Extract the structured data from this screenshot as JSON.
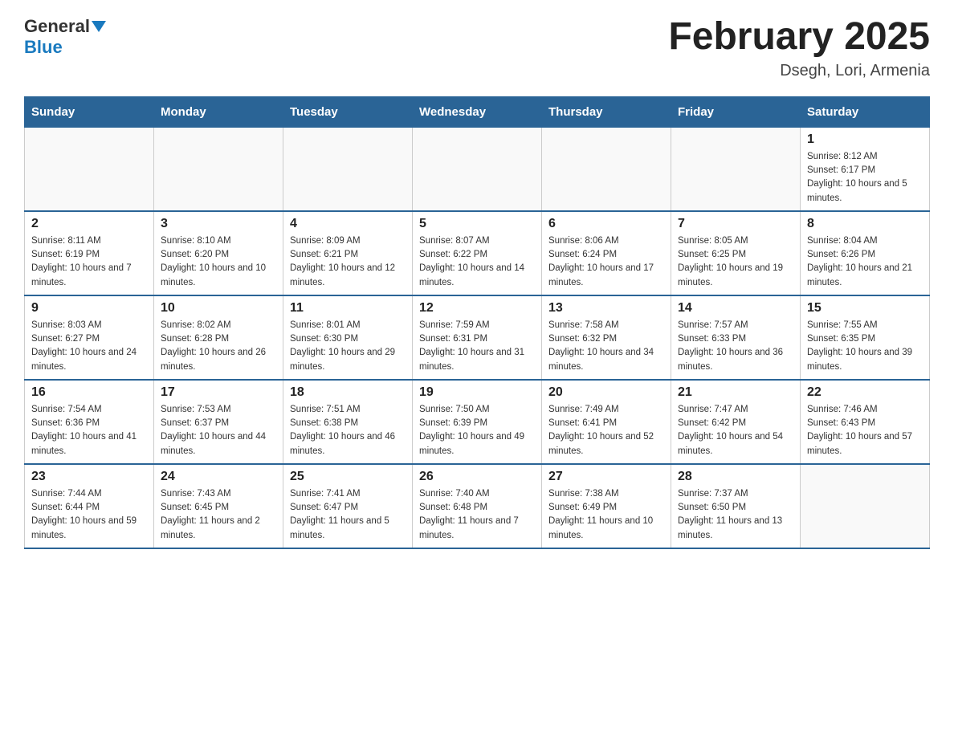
{
  "header": {
    "logo_general": "General",
    "logo_blue": "Blue",
    "month_title": "February 2025",
    "location": "Dsegh, Lori, Armenia"
  },
  "weekdays": [
    "Sunday",
    "Monday",
    "Tuesday",
    "Wednesday",
    "Thursday",
    "Friday",
    "Saturday"
  ],
  "weeks": [
    [
      {
        "day": "",
        "info": ""
      },
      {
        "day": "",
        "info": ""
      },
      {
        "day": "",
        "info": ""
      },
      {
        "day": "",
        "info": ""
      },
      {
        "day": "",
        "info": ""
      },
      {
        "day": "",
        "info": ""
      },
      {
        "day": "1",
        "info": "Sunrise: 8:12 AM\nSunset: 6:17 PM\nDaylight: 10 hours and 5 minutes."
      }
    ],
    [
      {
        "day": "2",
        "info": "Sunrise: 8:11 AM\nSunset: 6:19 PM\nDaylight: 10 hours and 7 minutes."
      },
      {
        "day": "3",
        "info": "Sunrise: 8:10 AM\nSunset: 6:20 PM\nDaylight: 10 hours and 10 minutes."
      },
      {
        "day": "4",
        "info": "Sunrise: 8:09 AM\nSunset: 6:21 PM\nDaylight: 10 hours and 12 minutes."
      },
      {
        "day": "5",
        "info": "Sunrise: 8:07 AM\nSunset: 6:22 PM\nDaylight: 10 hours and 14 minutes."
      },
      {
        "day": "6",
        "info": "Sunrise: 8:06 AM\nSunset: 6:24 PM\nDaylight: 10 hours and 17 minutes."
      },
      {
        "day": "7",
        "info": "Sunrise: 8:05 AM\nSunset: 6:25 PM\nDaylight: 10 hours and 19 minutes."
      },
      {
        "day": "8",
        "info": "Sunrise: 8:04 AM\nSunset: 6:26 PM\nDaylight: 10 hours and 21 minutes."
      }
    ],
    [
      {
        "day": "9",
        "info": "Sunrise: 8:03 AM\nSunset: 6:27 PM\nDaylight: 10 hours and 24 minutes."
      },
      {
        "day": "10",
        "info": "Sunrise: 8:02 AM\nSunset: 6:28 PM\nDaylight: 10 hours and 26 minutes."
      },
      {
        "day": "11",
        "info": "Sunrise: 8:01 AM\nSunset: 6:30 PM\nDaylight: 10 hours and 29 minutes."
      },
      {
        "day": "12",
        "info": "Sunrise: 7:59 AM\nSunset: 6:31 PM\nDaylight: 10 hours and 31 minutes."
      },
      {
        "day": "13",
        "info": "Sunrise: 7:58 AM\nSunset: 6:32 PM\nDaylight: 10 hours and 34 minutes."
      },
      {
        "day": "14",
        "info": "Sunrise: 7:57 AM\nSunset: 6:33 PM\nDaylight: 10 hours and 36 minutes."
      },
      {
        "day": "15",
        "info": "Sunrise: 7:55 AM\nSunset: 6:35 PM\nDaylight: 10 hours and 39 minutes."
      }
    ],
    [
      {
        "day": "16",
        "info": "Sunrise: 7:54 AM\nSunset: 6:36 PM\nDaylight: 10 hours and 41 minutes."
      },
      {
        "day": "17",
        "info": "Sunrise: 7:53 AM\nSunset: 6:37 PM\nDaylight: 10 hours and 44 minutes."
      },
      {
        "day": "18",
        "info": "Sunrise: 7:51 AM\nSunset: 6:38 PM\nDaylight: 10 hours and 46 minutes."
      },
      {
        "day": "19",
        "info": "Sunrise: 7:50 AM\nSunset: 6:39 PM\nDaylight: 10 hours and 49 minutes."
      },
      {
        "day": "20",
        "info": "Sunrise: 7:49 AM\nSunset: 6:41 PM\nDaylight: 10 hours and 52 minutes."
      },
      {
        "day": "21",
        "info": "Sunrise: 7:47 AM\nSunset: 6:42 PM\nDaylight: 10 hours and 54 minutes."
      },
      {
        "day": "22",
        "info": "Sunrise: 7:46 AM\nSunset: 6:43 PM\nDaylight: 10 hours and 57 minutes."
      }
    ],
    [
      {
        "day": "23",
        "info": "Sunrise: 7:44 AM\nSunset: 6:44 PM\nDaylight: 10 hours and 59 minutes."
      },
      {
        "day": "24",
        "info": "Sunrise: 7:43 AM\nSunset: 6:45 PM\nDaylight: 11 hours and 2 minutes."
      },
      {
        "day": "25",
        "info": "Sunrise: 7:41 AM\nSunset: 6:47 PM\nDaylight: 11 hours and 5 minutes."
      },
      {
        "day": "26",
        "info": "Sunrise: 7:40 AM\nSunset: 6:48 PM\nDaylight: 11 hours and 7 minutes."
      },
      {
        "day": "27",
        "info": "Sunrise: 7:38 AM\nSunset: 6:49 PM\nDaylight: 11 hours and 10 minutes."
      },
      {
        "day": "28",
        "info": "Sunrise: 7:37 AM\nSunset: 6:50 PM\nDaylight: 11 hours and 13 minutes."
      },
      {
        "day": "",
        "info": ""
      }
    ]
  ]
}
